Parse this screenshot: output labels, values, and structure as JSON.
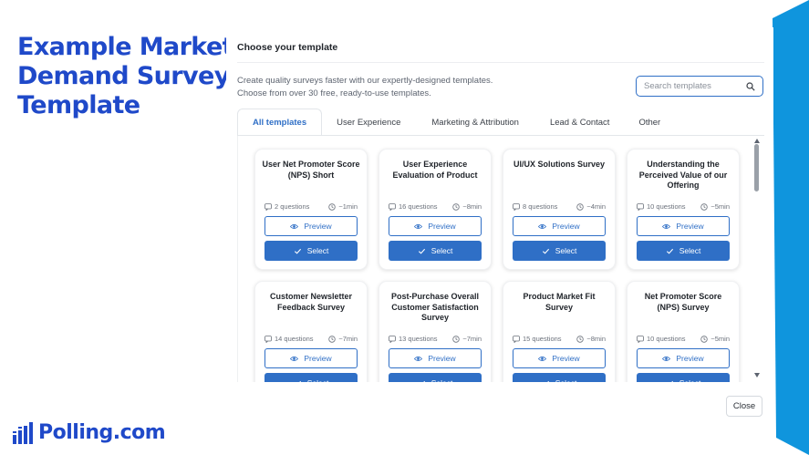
{
  "slide": {
    "title_lines": [
      "Example Market",
      "Demand Survey",
      "Template"
    ],
    "brand": "Polling.com"
  },
  "colors": {
    "brand_blue": "#1f49c9",
    "accent": "#2f6fc6",
    "side_shape": "#0f95dd"
  },
  "modal": {
    "title": "Choose your template",
    "description": [
      "Create quality surveys faster with our expertly-designed templates.",
      "Choose from over 30 free, ready-to-use templates."
    ],
    "search_placeholder": "Search templates",
    "tabs": [
      {
        "label": "All templates",
        "active": true
      },
      {
        "label": "User Experience",
        "active": false
      },
      {
        "label": "Marketing & Attribution",
        "active": false
      },
      {
        "label": "Lead & Contact",
        "active": false
      },
      {
        "label": "Other",
        "active": false
      }
    ],
    "cards": [
      {
        "title": "User Net Promoter Score (NPS) Short",
        "questions": "2 questions",
        "time": "~1min"
      },
      {
        "title": "User Experience Evaluation of Product",
        "questions": "16 questions",
        "time": "~8min"
      },
      {
        "title": "UI/UX Solutions Survey",
        "questions": "8 questions",
        "time": "~4min"
      },
      {
        "title": "Understanding the Perceived Value of our Offering",
        "questions": "10 questions",
        "time": "~5min"
      },
      {
        "title": "Customer Newsletter Feedback Survey",
        "questions": "14 questions",
        "time": "~7min"
      },
      {
        "title": "Post-Purchase Overall Customer Satisfaction Survey",
        "questions": "13 questions",
        "time": "~7min"
      },
      {
        "title": "Product Market Fit Survey",
        "questions": "15 questions",
        "time": "~8min"
      },
      {
        "title": "Net Promoter Score (NPS) Survey",
        "questions": "10 questions",
        "time": "~5min"
      }
    ],
    "preview_label": "Preview",
    "select_label": "Select",
    "close_label": "Close"
  }
}
